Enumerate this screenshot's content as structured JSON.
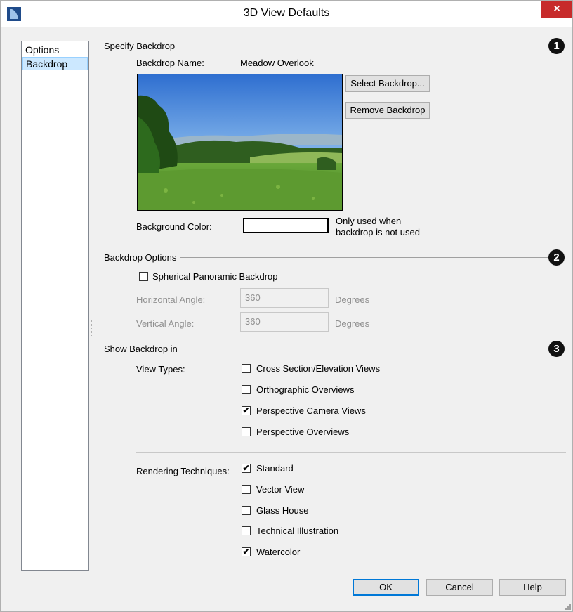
{
  "window": {
    "title": "3D View Defaults",
    "close_glyph": "×"
  },
  "sidebar": {
    "items": [
      {
        "label": "Options"
      },
      {
        "label": "Backdrop"
      }
    ]
  },
  "specify_backdrop": {
    "section_title": "Specify Backdrop",
    "badge": "1",
    "name_label": "Backdrop Name:",
    "name_value": "Meadow Overlook",
    "select_button": "Select Backdrop...",
    "remove_button": "Remove Backdrop",
    "background_color_label": "Background Color:",
    "background_color_value": "#ffffff",
    "background_note_line1": "Only used when",
    "background_note_line2": "backdrop is not used"
  },
  "backdrop_options": {
    "section_title": "Backdrop Options",
    "badge": "2",
    "spherical_label": "Spherical Panoramic Backdrop",
    "spherical_checked": false,
    "horizontal_label": "Horizontal Angle:",
    "horizontal_value": "360",
    "vertical_label": "Vertical Angle:",
    "vertical_value": "360",
    "unit": "Degrees"
  },
  "show_backdrop": {
    "section_title": "Show Backdrop in",
    "badge": "3",
    "view_types_label": "View Types:",
    "view_types": [
      {
        "label": "Cross Section/Elevation Views",
        "checked": false
      },
      {
        "label": "Orthographic Overviews",
        "checked": false
      },
      {
        "label": "Perspective Camera Views",
        "checked": true
      },
      {
        "label": "Perspective Overviews",
        "checked": false
      }
    ],
    "rendering_label": "Rendering Techniques:",
    "rendering": [
      {
        "label": "Standard",
        "checked": true
      },
      {
        "label": "Vector View",
        "checked": false
      },
      {
        "label": "Glass House",
        "checked": false
      },
      {
        "label": "Technical Illustration",
        "checked": false
      },
      {
        "label": "Watercolor",
        "checked": true
      }
    ],
    "check_glyph": "✔"
  },
  "footer": {
    "ok": "OK",
    "cancel": "Cancel",
    "help": "Help"
  },
  "colors": {
    "selection": "#cce8ff",
    "close": "#c72b2b",
    "app_icon": "#1f4b8a"
  },
  "icons": {
    "app": "app-logo-icon",
    "close": "close-icon"
  }
}
